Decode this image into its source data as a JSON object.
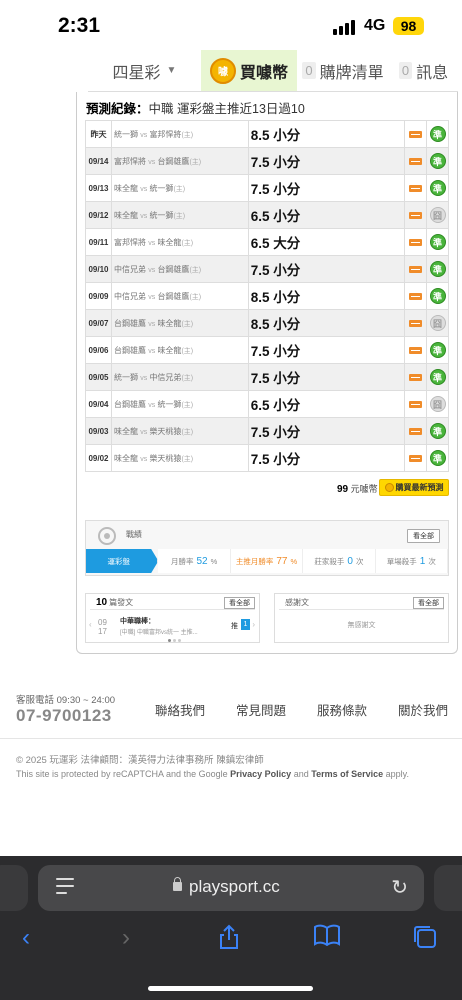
{
  "status": {
    "time": "2:31",
    "network": "4G",
    "battery": "98"
  },
  "tabs": {
    "lottery": "四星彩",
    "buy_coin_icon": "噱",
    "buy": "買噱幣",
    "cart_count": "0",
    "cart": "購牌清單",
    "msg_count": "0",
    "msg": "訊息"
  },
  "record": {
    "title_bold": "預測紀錄：",
    "title_rest": "中職 運彩盤主推近13日過10",
    "rows": [
      {
        "date": "昨天",
        "home": "統一獅",
        "away": "富邦悍將",
        "pred": "8.5 小分",
        "result": "準",
        "hit": true
      },
      {
        "date": "09/14",
        "home": "富邦悍將",
        "away": "台鋼雄鷹",
        "pred": "7.5 小分",
        "result": "準",
        "hit": true
      },
      {
        "date": "09/13",
        "home": "味全龍",
        "away": "統一獅",
        "pred": "7.5 小分",
        "result": "準",
        "hit": true
      },
      {
        "date": "09/12",
        "home": "味全龍",
        "away": "統一獅",
        "pred": "6.5 小分",
        "result": "囧",
        "hit": false
      },
      {
        "date": "09/11",
        "home": "富邦悍將",
        "away": "味全龍",
        "pred": "6.5 大分",
        "result": "準",
        "hit": true
      },
      {
        "date": "09/10",
        "home": "中信兄弟",
        "away": "台鋼雄鷹",
        "pred": "7.5 小分",
        "result": "準",
        "hit": true
      },
      {
        "date": "09/09",
        "home": "中信兄弟",
        "away": "台鋼雄鷹",
        "pred": "8.5 小分",
        "result": "準",
        "hit": true
      },
      {
        "date": "09/07",
        "home": "台鋼雄鷹",
        "away": "味全龍",
        "pred": "8.5 小分",
        "result": "囧",
        "hit": false
      },
      {
        "date": "09/06",
        "home": "台鋼雄鷹",
        "away": "味全龍",
        "pred": "7.5 小分",
        "result": "準",
        "hit": true
      },
      {
        "date": "09/05",
        "home": "統一獅",
        "away": "中信兄弟",
        "pred": "7.5 小分",
        "result": "準",
        "hit": true
      },
      {
        "date": "09/04",
        "home": "台鋼雄鷹",
        "away": "統一獅",
        "pred": "6.5 小分",
        "result": "囧",
        "hit": false
      },
      {
        "date": "09/03",
        "home": "味全龍",
        "away": "樂天桃猿",
        "pred": "7.5 小分",
        "result": "準",
        "hit": true
      },
      {
        "date": "09/02",
        "home": "味全龍",
        "away": "樂天桃猿",
        "pred": "7.5 小分",
        "result": "準",
        "hit": true
      }
    ],
    "vs": "vs",
    "home_mark": "(主)",
    "coins": "99",
    "coins_unit": "元噱幣",
    "buy_latest": "購買最新預測"
  },
  "stats": {
    "title": "戰績",
    "all": "看全部",
    "items": [
      {
        "label": "運彩盤",
        "num": "",
        "unit": ""
      },
      {
        "label": "月勝率",
        "num": "52",
        "unit": "%"
      },
      {
        "label": "主推月勝率",
        "num": "77",
        "unit": "%"
      },
      {
        "label": "莊家殺手",
        "num": "0",
        "unit": "次"
      },
      {
        "label": "單場殺手",
        "num": "1",
        "unit": "次"
      }
    ]
  },
  "articles": {
    "count": "10",
    "title": "篇發文",
    "all": "看全部",
    "month": "09",
    "day": "17",
    "art_title": "中華職棒：",
    "art_sub": "[中職] 中職富邦vs統一 主推...",
    "rec": "推",
    "rec_count": "1"
  },
  "replies": {
    "title": "感謝文",
    "all": "看全部",
    "empty": "無感謝文"
  },
  "footer": {
    "service": "客服電話 09:30 ~ 24:00",
    "phone": "07-9700123",
    "links": [
      "聯絡我們",
      "常見問題",
      "服務條款",
      "關於我們"
    ],
    "copyright": "© 2025 玩運彩 法律顧問：漢英得力法律事務所 陳鎮宏律師",
    "recaptcha_pre": "This site is protected by reCAPTCHA and the Google",
    "privacy": "Privacy Policy",
    "and": "and",
    "terms": "Terms of Service",
    "apply": "apply."
  },
  "browser": {
    "url": "playsport.cc"
  },
  "colors": {
    "accent": "#1e9be0",
    "hit": "#49b43b",
    "highlight": "#e8f6d2",
    "coin": "#ffd700"
  }
}
